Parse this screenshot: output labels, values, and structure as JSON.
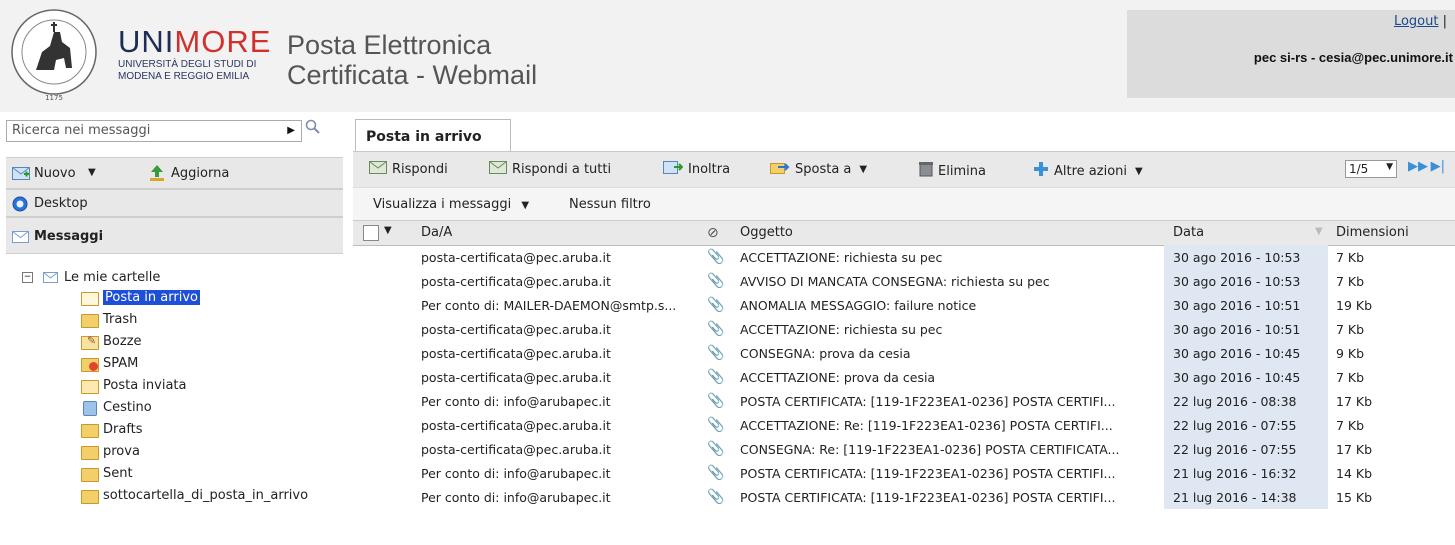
{
  "header": {
    "brand_uni": "UNI",
    "brand_more": "MORE",
    "brand_sub1": "UNIVERSITÀ DEGLI STUDI DI",
    "brand_sub2": "MODENA E REGGIO EMILIA",
    "title_line1": "Posta Elettronica",
    "title_line2": "Certificata - Webmail",
    "logout": "Logout",
    "separator": "|",
    "user": "pec si-rs - cesia@pec.unimore.it",
    "seal_year": "1175"
  },
  "sidebar": {
    "search_placeholder": "Ricerca nei messaggi",
    "new_label": "Nuovo",
    "refresh_label": "Aggiorna",
    "desktop_label": "Desktop",
    "messages_label": "Messaggi",
    "root_label": "Le mie cartelle",
    "folders": [
      {
        "label": "Posta in arrivo",
        "icon": "inbox-icon"
      },
      {
        "label": "Trash",
        "icon": "folder-icon"
      },
      {
        "label": "Bozze",
        "icon": "drafts-icon"
      },
      {
        "label": "SPAM",
        "icon": "spam-icon"
      },
      {
        "label": "Posta inviata",
        "icon": "sent-icon"
      },
      {
        "label": "Cestino",
        "icon": "trash-bin-icon"
      },
      {
        "label": "Drafts",
        "icon": "folder-icon"
      },
      {
        "label": "prova",
        "icon": "folder-icon"
      },
      {
        "label": "Sent",
        "icon": "folder-icon"
      },
      {
        "label": "sottocartella_di_posta_in_arrivo",
        "icon": "folder-icon"
      }
    ]
  },
  "main": {
    "tab": "Posta in arrivo",
    "toolbar": {
      "reply": "Rispondi",
      "reply_all": "Rispondi a tutti",
      "forward": "Inoltra",
      "move": "Sposta a",
      "delete": "Elimina",
      "more": "Altre azioni",
      "page": "1/5"
    },
    "filter": {
      "view": "Visualizza i messaggi",
      "none": "Nessun filtro"
    },
    "columns": {
      "from": "Da/A",
      "subject": "Oggetto",
      "date": "Data",
      "size": "Dimensioni"
    },
    "messages": [
      {
        "from": "posta-certificata@pec.aruba.it",
        "subject": "ACCETTAZIONE: richiesta su pec",
        "date": "30 ago 2016 - 10:53",
        "size": "7 Kb"
      },
      {
        "from": "posta-certificata@pec.aruba.it",
        "subject": "AVVISO DI MANCATA CONSEGNA: richiesta su pec",
        "date": "30 ago 2016 - 10:53",
        "size": "7 Kb"
      },
      {
        "from": "Per conto di: MAILER-DAEMON@smtp.s...",
        "subject": "ANOMALIA MESSAGGIO: failure notice",
        "date": "30 ago 2016 - 10:51",
        "size": "19 Kb"
      },
      {
        "from": "posta-certificata@pec.aruba.it",
        "subject": "ACCETTAZIONE: richiesta su pec",
        "date": "30 ago 2016 - 10:51",
        "size": "7 Kb"
      },
      {
        "from": "posta-certificata@pec.aruba.it",
        "subject": "CONSEGNA: prova da cesia",
        "date": "30 ago 2016 - 10:45",
        "size": "9 Kb"
      },
      {
        "from": "posta-certificata@pec.aruba.it",
        "subject": "ACCETTAZIONE: prova da cesia",
        "date": "30 ago 2016 - 10:45",
        "size": "7 Kb"
      },
      {
        "from": "Per conto di: info@arubapec.it",
        "subject": "POSTA CERTIFICATA: [119-1F223EA1-0236] POSTA CERTIFI...",
        "date": "22 lug 2016 - 08:38",
        "size": "17 Kb"
      },
      {
        "from": "posta-certificata@pec.aruba.it",
        "subject": "ACCETTAZIONE: Re: [119-1F223EA1-0236] POSTA CERTIFI...",
        "date": "22 lug 2016 - 07:55",
        "size": "7 Kb"
      },
      {
        "from": "posta-certificata@pec.aruba.it",
        "subject": "CONSEGNA: Re: [119-1F223EA1-0236] POSTA CERTIFICATA...",
        "date": "22 lug 2016 - 07:55",
        "size": "17 Kb"
      },
      {
        "from": "Per conto di: info@arubapec.it",
        "subject": "POSTA CERTIFICATA: [119-1F223EA1-0236] POSTA CERTIFI...",
        "date": "21 lug 2016 - 16:32",
        "size": "14 Kb"
      },
      {
        "from": "Per conto di: info@arubapec.it",
        "subject": "POSTA CERTIFICATA: [119-1F223EA1-0236] POSTA CERTIFI...",
        "date": "21 lug 2016 - 14:38",
        "size": "15 Kb"
      }
    ]
  }
}
